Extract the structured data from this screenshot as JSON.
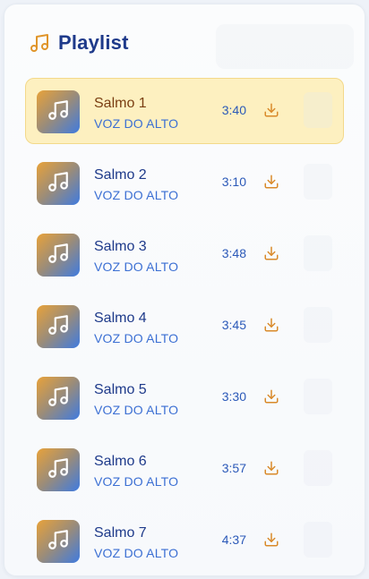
{
  "playlist": {
    "title": "Playlist",
    "tracks": [
      {
        "name": "Salmo 1",
        "artist": "VOZ DO ALTO",
        "duration": "3:40",
        "active": true
      },
      {
        "name": "Salmo 2",
        "artist": "VOZ DO ALTO",
        "duration": "3:10",
        "active": false
      },
      {
        "name": "Salmo 3",
        "artist": "VOZ DO ALTO",
        "duration": "3:48",
        "active": false
      },
      {
        "name": "Salmo 4",
        "artist": "VOZ DO ALTO",
        "duration": "3:45",
        "active": false
      },
      {
        "name": "Salmo 5",
        "artist": "VOZ DO ALTO",
        "duration": "3:30",
        "active": false
      },
      {
        "name": "Salmo 6",
        "artist": "VOZ DO ALTO",
        "duration": "3:57",
        "active": false
      },
      {
        "name": "Salmo 7",
        "artist": "VOZ DO ALTO",
        "duration": "4:37",
        "active": false
      }
    ]
  },
  "icons": {
    "header": "music-note-icon",
    "artwork": "music-note-icon",
    "download": "download-icon"
  },
  "colors": {
    "accent": "#e0952a",
    "title": "#1e3a8a",
    "artist": "#3b6fd3",
    "active_bg": "#fdf0c0"
  }
}
